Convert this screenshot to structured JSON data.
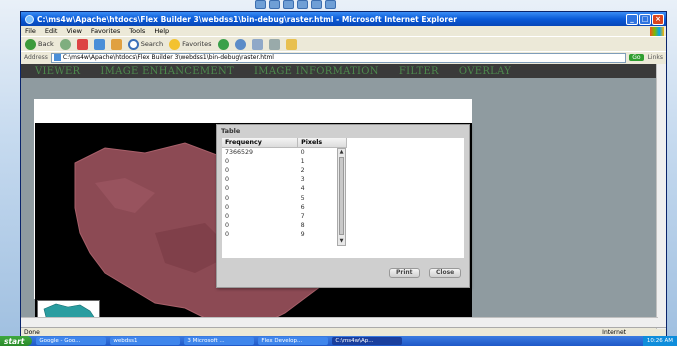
{
  "window": {
    "title": "C:\\ms4w\\Apache\\htdocs\\Flex Builder 3\\webdss1\\bin-debug\\raster.html - Microsoft Internet Explorer"
  },
  "menu": [
    "File",
    "Edit",
    "View",
    "Favorites",
    "Tools",
    "Help"
  ],
  "toolbar": {
    "back": "Back",
    "search": "Search",
    "favorites": "Favorites"
  },
  "address": {
    "label": "Address",
    "url": "C:\\ms4w\\Apache\\htdocs\\Flex Builder 3\\webdss1\\bin-debug\\raster.html",
    "go": "Go",
    "links": "Links"
  },
  "nav": [
    "VIEWER",
    "IMAGE ENHANCEMENT",
    "IMAGE INFORMATION",
    "FILTER",
    "OVERLAY"
  ],
  "dialog": {
    "title": "Table",
    "columns": [
      "Frequency",
      "Pixels"
    ],
    "rows": [
      [
        "7366529",
        "0"
      ],
      [
        "0",
        "1"
      ],
      [
        "0",
        "2"
      ],
      [
        "0",
        "3"
      ],
      [
        "0",
        "4"
      ],
      [
        "0",
        "5"
      ],
      [
        "0",
        "6"
      ],
      [
        "0",
        "7"
      ],
      [
        "0",
        "8"
      ],
      [
        "0",
        "9"
      ]
    ],
    "print": "Print",
    "close": "Close"
  },
  "status": {
    "left": "Done",
    "zone": "Internet"
  },
  "taskbar": {
    "start": "start",
    "tasks": [
      "Google - Goo...",
      "webdss1",
      "3 Microsoft ...",
      "Flex Develop...",
      "C:\\ms4w\\Ap..."
    ],
    "clock": "10:26 AM"
  },
  "colors": {
    "nav_text": "#4d8a4d",
    "map_red": "#8c4a54"
  }
}
